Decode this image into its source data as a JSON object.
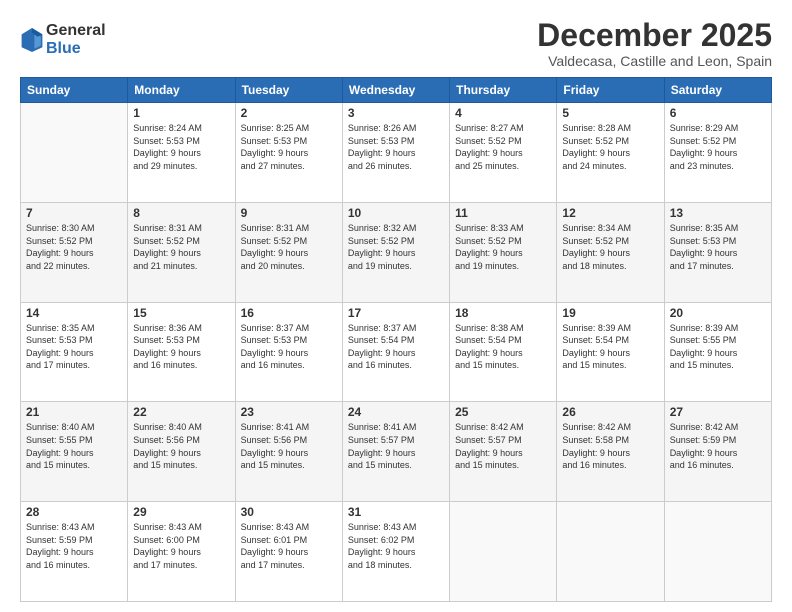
{
  "logo": {
    "general": "General",
    "blue": "Blue"
  },
  "title": "December 2025",
  "subtitle": "Valdecasa, Castille and Leon, Spain",
  "weekdays": [
    "Sunday",
    "Monday",
    "Tuesday",
    "Wednesday",
    "Thursday",
    "Friday",
    "Saturday"
  ],
  "weeks": [
    [
      {
        "day": "",
        "info": ""
      },
      {
        "day": "1",
        "info": "Sunrise: 8:24 AM\nSunset: 5:53 PM\nDaylight: 9 hours\nand 29 minutes."
      },
      {
        "day": "2",
        "info": "Sunrise: 8:25 AM\nSunset: 5:53 PM\nDaylight: 9 hours\nand 27 minutes."
      },
      {
        "day": "3",
        "info": "Sunrise: 8:26 AM\nSunset: 5:53 PM\nDaylight: 9 hours\nand 26 minutes."
      },
      {
        "day": "4",
        "info": "Sunrise: 8:27 AM\nSunset: 5:52 PM\nDaylight: 9 hours\nand 25 minutes."
      },
      {
        "day": "5",
        "info": "Sunrise: 8:28 AM\nSunset: 5:52 PM\nDaylight: 9 hours\nand 24 minutes."
      },
      {
        "day": "6",
        "info": "Sunrise: 8:29 AM\nSunset: 5:52 PM\nDaylight: 9 hours\nand 23 minutes."
      }
    ],
    [
      {
        "day": "7",
        "info": "Sunrise: 8:30 AM\nSunset: 5:52 PM\nDaylight: 9 hours\nand 22 minutes."
      },
      {
        "day": "8",
        "info": "Sunrise: 8:31 AM\nSunset: 5:52 PM\nDaylight: 9 hours\nand 21 minutes."
      },
      {
        "day": "9",
        "info": "Sunrise: 8:31 AM\nSunset: 5:52 PM\nDaylight: 9 hours\nand 20 minutes."
      },
      {
        "day": "10",
        "info": "Sunrise: 8:32 AM\nSunset: 5:52 PM\nDaylight: 9 hours\nand 19 minutes."
      },
      {
        "day": "11",
        "info": "Sunrise: 8:33 AM\nSunset: 5:52 PM\nDaylight: 9 hours\nand 19 minutes."
      },
      {
        "day": "12",
        "info": "Sunrise: 8:34 AM\nSunset: 5:52 PM\nDaylight: 9 hours\nand 18 minutes."
      },
      {
        "day": "13",
        "info": "Sunrise: 8:35 AM\nSunset: 5:53 PM\nDaylight: 9 hours\nand 17 minutes."
      }
    ],
    [
      {
        "day": "14",
        "info": "Sunrise: 8:35 AM\nSunset: 5:53 PM\nDaylight: 9 hours\nand 17 minutes."
      },
      {
        "day": "15",
        "info": "Sunrise: 8:36 AM\nSunset: 5:53 PM\nDaylight: 9 hours\nand 16 minutes."
      },
      {
        "day": "16",
        "info": "Sunrise: 8:37 AM\nSunset: 5:53 PM\nDaylight: 9 hours\nand 16 minutes."
      },
      {
        "day": "17",
        "info": "Sunrise: 8:37 AM\nSunset: 5:54 PM\nDaylight: 9 hours\nand 16 minutes."
      },
      {
        "day": "18",
        "info": "Sunrise: 8:38 AM\nSunset: 5:54 PM\nDaylight: 9 hours\nand 15 minutes."
      },
      {
        "day": "19",
        "info": "Sunrise: 8:39 AM\nSunset: 5:54 PM\nDaylight: 9 hours\nand 15 minutes."
      },
      {
        "day": "20",
        "info": "Sunrise: 8:39 AM\nSunset: 5:55 PM\nDaylight: 9 hours\nand 15 minutes."
      }
    ],
    [
      {
        "day": "21",
        "info": "Sunrise: 8:40 AM\nSunset: 5:55 PM\nDaylight: 9 hours\nand 15 minutes."
      },
      {
        "day": "22",
        "info": "Sunrise: 8:40 AM\nSunset: 5:56 PM\nDaylight: 9 hours\nand 15 minutes."
      },
      {
        "day": "23",
        "info": "Sunrise: 8:41 AM\nSunset: 5:56 PM\nDaylight: 9 hours\nand 15 minutes."
      },
      {
        "day": "24",
        "info": "Sunrise: 8:41 AM\nSunset: 5:57 PM\nDaylight: 9 hours\nand 15 minutes."
      },
      {
        "day": "25",
        "info": "Sunrise: 8:42 AM\nSunset: 5:57 PM\nDaylight: 9 hours\nand 15 minutes."
      },
      {
        "day": "26",
        "info": "Sunrise: 8:42 AM\nSunset: 5:58 PM\nDaylight: 9 hours\nand 16 minutes."
      },
      {
        "day": "27",
        "info": "Sunrise: 8:42 AM\nSunset: 5:59 PM\nDaylight: 9 hours\nand 16 minutes."
      }
    ],
    [
      {
        "day": "28",
        "info": "Sunrise: 8:43 AM\nSunset: 5:59 PM\nDaylight: 9 hours\nand 16 minutes."
      },
      {
        "day": "29",
        "info": "Sunrise: 8:43 AM\nSunset: 6:00 PM\nDaylight: 9 hours\nand 17 minutes."
      },
      {
        "day": "30",
        "info": "Sunrise: 8:43 AM\nSunset: 6:01 PM\nDaylight: 9 hours\nand 17 minutes."
      },
      {
        "day": "31",
        "info": "Sunrise: 8:43 AM\nSunset: 6:02 PM\nDaylight: 9 hours\nand 18 minutes."
      },
      {
        "day": "",
        "info": ""
      },
      {
        "day": "",
        "info": ""
      },
      {
        "day": "",
        "info": ""
      }
    ]
  ]
}
